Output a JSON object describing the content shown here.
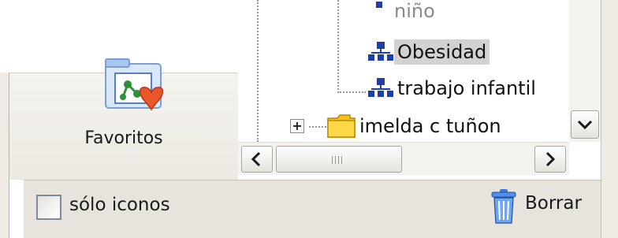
{
  "favorites": {
    "label": "Favoritos",
    "icon": "favorites-folder-heart-icon"
  },
  "tree": {
    "items": [
      {
        "label": "niño",
        "icon": "node-org-icon",
        "selected": false
      },
      {
        "label": "Obesidad",
        "icon": "node-org-icon",
        "selected": true
      },
      {
        "label": "trabajo infantil",
        "icon": "node-org-icon",
        "selected": false
      },
      {
        "label": "imelda c tuñon",
        "icon": "folder-icon",
        "selected": false,
        "expander": "+"
      }
    ]
  },
  "hscroll": {
    "grip": "IIII"
  },
  "bottom": {
    "icons_only_label": "sólo iconos",
    "icons_only_checked": false,
    "delete_label": "Borrar",
    "delete_icon": "trash-icon"
  },
  "colors": {
    "selection": "#d4d2d0",
    "panel": "#e7e4de",
    "folder": "#f4c21a",
    "heart": "#e8562a",
    "node_blue": "#1f3fa8"
  }
}
